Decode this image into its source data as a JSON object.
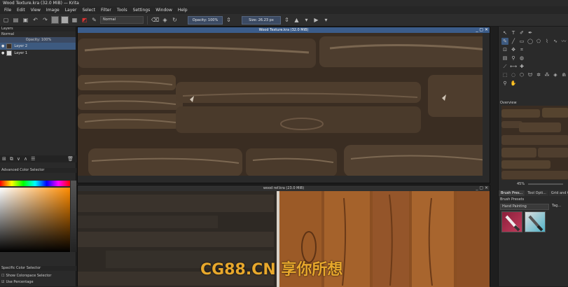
{
  "window_title": "Wood Texture.kra (32.0 MiB) — Krita",
  "menu": [
    "File",
    "Edit",
    "View",
    "Image",
    "Layer",
    "Select",
    "Filter",
    "Tools",
    "Settings",
    "Window",
    "Help"
  ],
  "toolbar": {
    "blend_mode": "Normal",
    "opacity_label": "Opacity: 100%",
    "size_label": "Size: 26.23 px"
  },
  "layers_panel": {
    "title": "Layers",
    "mode": "Normal",
    "opacity": "Opacity: 100%",
    "layers": [
      {
        "name": "Layer 2",
        "selected": true
      },
      {
        "name": "Layer 1",
        "selected": false
      }
    ]
  },
  "color_panel": {
    "title": "Advanced Color Selector",
    "specific_title": "Specific Color Selector",
    "option1": "Show Colorspace Selector",
    "option2": "Use Percentage"
  },
  "canvas_main": {
    "title": "Wood Texture.kra (32.0 MiB)"
  },
  "canvas_ref": {
    "title": "wood ref.kra (23.0 MiB)"
  },
  "right_panel": {
    "overview_title": "Overview",
    "zoom": "45%",
    "tabs": [
      "Brush Pres...",
      "Tool Opti...",
      "Grid and Gu..."
    ],
    "brush_presets_title": "Brush Presets",
    "brush_filter": "Hand Painting",
    "tag_label": "Tag..."
  },
  "watermark": "CG88.CN 享你所想",
  "colors": {
    "accent": "#3d5a80",
    "title_active": "#3b5c8a",
    "watermark": "#e8a82c"
  }
}
